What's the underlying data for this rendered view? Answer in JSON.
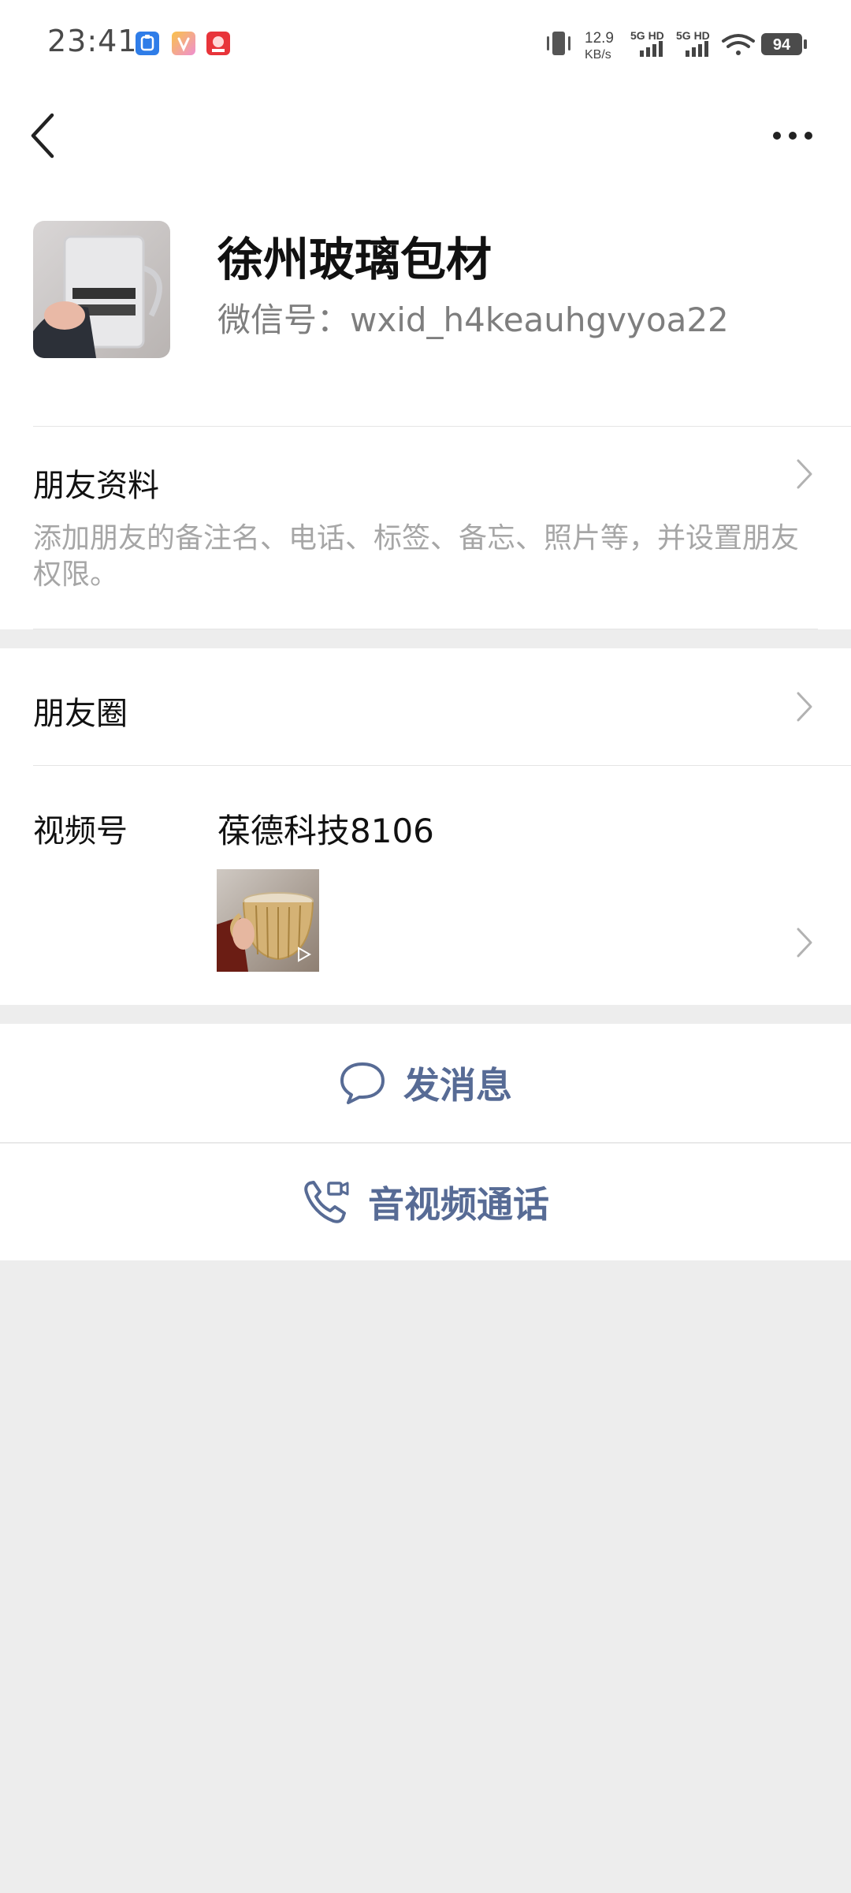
{
  "status_bar": {
    "time": "23:41",
    "net_speed_value": "12.9",
    "net_speed_unit": "KB/s",
    "signal_1_label": "5G HD",
    "signal_2_label": "5G HD",
    "battery": "94"
  },
  "profile": {
    "name": "徐州玻璃包材",
    "wechat_id": "微信号：wxid_h4keauhgvyoa22",
    "avatar_icon": "glass-mug-photo"
  },
  "friend_info": {
    "title": "朋友资料",
    "description": "添加朋友的备注名、电话、标签、备忘、照片等，并设置朋友权限。"
  },
  "moments": {
    "title": "朋友圈"
  },
  "channels": {
    "title": "视频号",
    "channel_name": "葆德科技8106",
    "thumbnail_icon": "glass-cup-video"
  },
  "actions": {
    "send_message": "发消息",
    "av_call": "音视频通话"
  },
  "colors": {
    "accent": "#576b95",
    "background": "#ededed",
    "card": "#ffffff",
    "secondary_text": "#7e7e7e"
  }
}
